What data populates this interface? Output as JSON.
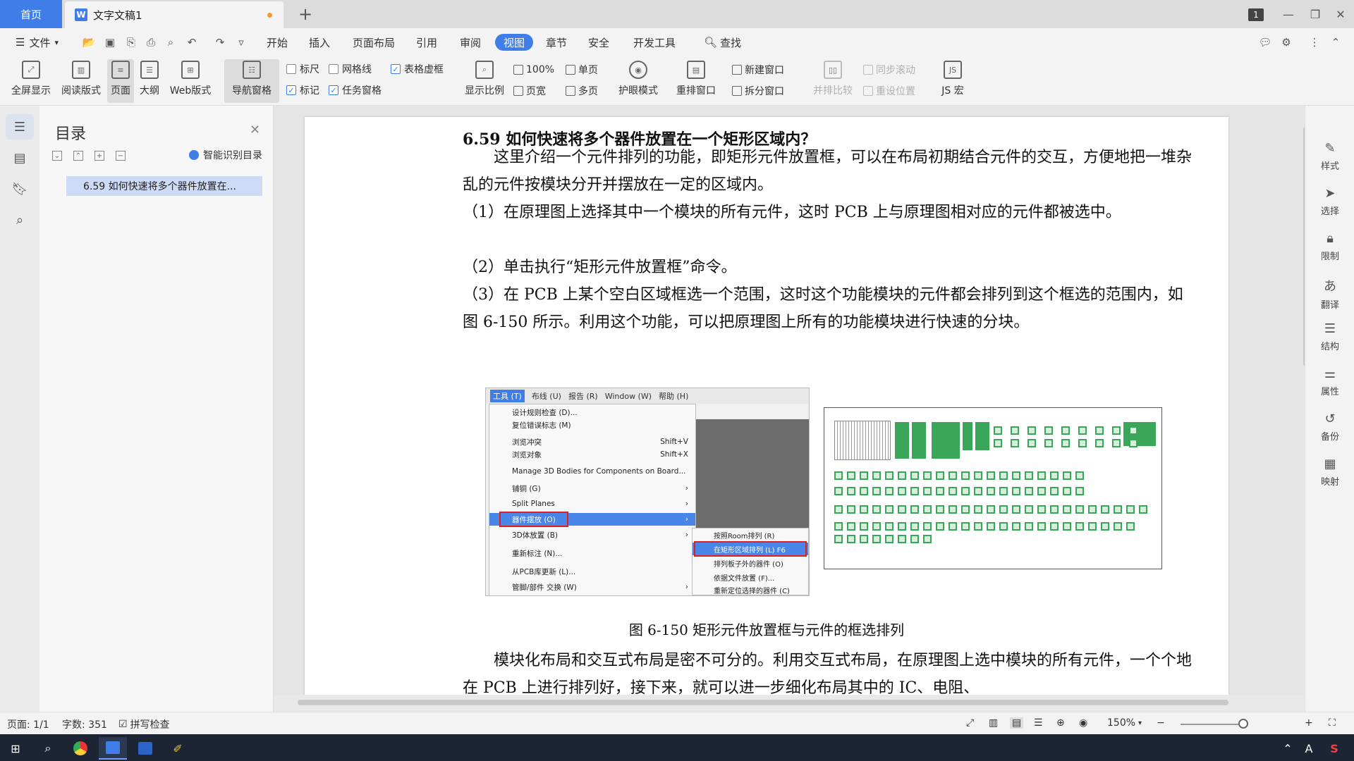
{
  "titlebar": {
    "home_tab": "首页",
    "doc_tab": "文字文稿1",
    "doc_icon": "W",
    "new_tab": "+",
    "page_badge": "1"
  },
  "menubar": {
    "file": "文件",
    "items": [
      "开始",
      "插入",
      "页面布局",
      "引用",
      "审阅",
      "视图",
      "章节",
      "安全",
      "开发工具"
    ],
    "active": "视图",
    "search": "查找"
  },
  "toolbar": {
    "fullscreen": "全屏显示",
    "reading": "阅读版式",
    "page": "页面",
    "outline": "大纲",
    "web": "Web版式",
    "nav_pane": "导航窗格",
    "ruler": "标尺",
    "gridlines": "网格线",
    "table_grid": "表格虚框",
    "marks": "标记",
    "task_pane": "任务窗格",
    "display_ratio": "显示比例",
    "zoom100": "100%",
    "page_width": "页宽",
    "single_page": "单页",
    "multi_page": "多页",
    "eye_mode": "护眼模式",
    "rearrange": "重排窗口",
    "new_window": "新建窗口",
    "split_window": "拆分窗口",
    "side_by_side": "并排比较",
    "sync_scroll": "同步滚动",
    "reset_pos": "重设位置",
    "js_macro": "JS 宏"
  },
  "toc": {
    "title": "目录",
    "ai_label": "智能识别目录",
    "item": "6.59   如何快速将多个器件放置在..."
  },
  "document": {
    "heading": "6.59    如何快速将多个器件放置在一个矩形区域内？",
    "p1": "这里介绍一个元件排列的功能，即矩形元件放置框，可以在布局初期结合元件的交互，方便地把一堆杂乱的元件按模块分开并摆放在一定的区域内。",
    "p2": "（1）在原理图上选择其中一个模块的所有元件，这时 PCB 上与原理图相对应的元件都被选中。",
    "p3": "（2）单击执行“矩形元件放置框”命令。",
    "p4": "（3）在 PCB 上某个空白区域框选一个范围，这时这个功能模块的元件都会排列到这个框选的范围内，如图 6-150 所示。利用这个功能，可以把原理图上所有的功能模块进行快速的分块。",
    "caption": "图 6-150    矩形元件放置框与元件的框选排列",
    "p5": "模块化布局和交互式布局是密不可分的。利用交互式布局，在原理图上选中模块的所有元件，一个个地在 PCB 上进行排列好，接下来，就可以进一步细化布局其中的 IC、电阻、"
  },
  "figure": {
    "menubar": [
      "工具 (T)",
      "布线 (U)",
      "报告 (R)",
      "Window (W)",
      "帮助 (H)"
    ],
    "items": [
      {
        "label": "设计规则检查 (D)...",
        "key": ""
      },
      {
        "label": "复位错误标志 (M)",
        "key": ""
      },
      {
        "label": "浏览冲突",
        "key": "Shift+V"
      },
      {
        "label": "浏览对象",
        "key": "Shift+X"
      },
      {
        "label": "Manage 3D Bodies for Components on Board...",
        "key": ""
      },
      {
        "label": "铺铜 (G)",
        "key": "›"
      },
      {
        "label": "Split Planes",
        "key": "›"
      },
      {
        "label": "器件摆放 (O)",
        "key": "›"
      },
      {
        "label": "3D体放置 (B)",
        "key": "›"
      },
      {
        "label": "重新标注 (N)...",
        "key": ""
      },
      {
        "label": "从PCB库更新 (L)...",
        "key": ""
      },
      {
        "label": "管脚/部件 交换 (W)",
        "key": "›"
      }
    ],
    "submenu": [
      "按照Room排列 (R)",
      "在矩形区域排列 (L)    F6",
      "排列板子外的器件 (O)",
      "依据文件放置 (F)...",
      "重新定位选择的器件 (C)"
    ]
  },
  "rightrail": [
    "样式",
    "选择",
    "限制",
    "翻译",
    "结构",
    "属性",
    "备份",
    "映射"
  ],
  "statusbar": {
    "page": "页面: 1/1",
    "words": "字数: 351",
    "spell": "拼写检查",
    "zoom": "150%"
  }
}
